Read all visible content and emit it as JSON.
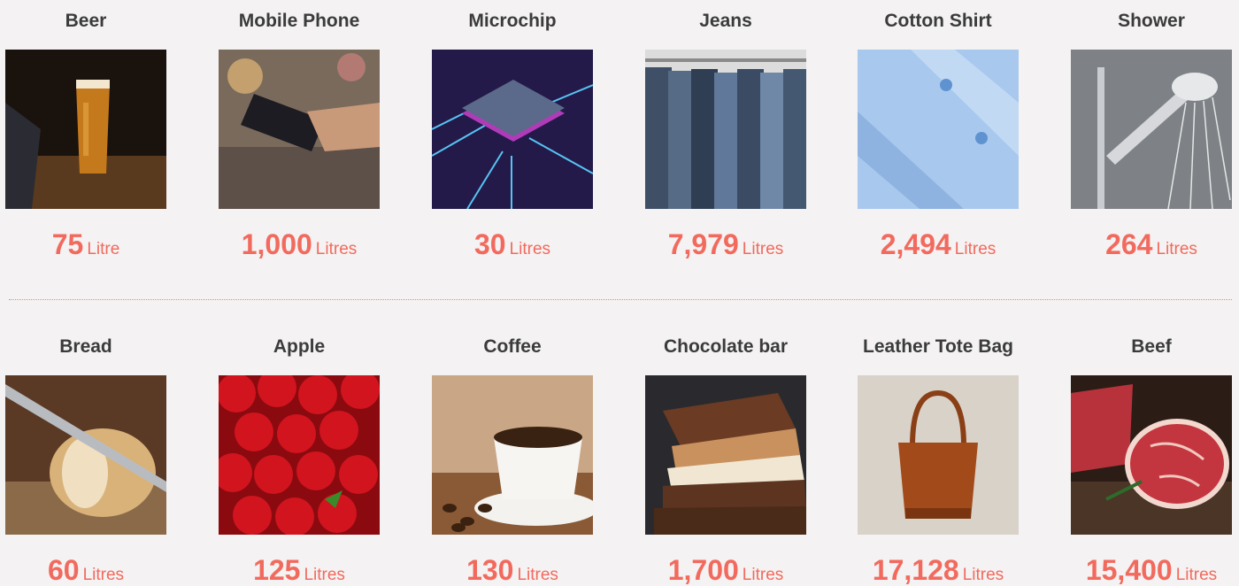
{
  "row1": [
    {
      "label": "Beer",
      "value": "75",
      "unit": "Litre"
    },
    {
      "label": "Mobile Phone",
      "value": "1,000",
      "unit": "Litres"
    },
    {
      "label": "Microchip",
      "value": "30",
      "unit": "Litres"
    },
    {
      "label": "Jeans",
      "value": "7,979",
      "unit": "Litres"
    },
    {
      "label": "Cotton Shirt",
      "value": "2,494",
      "unit": "Litres"
    },
    {
      "label": "Shower",
      "value": "264",
      "unit": "Litres"
    }
  ],
  "row2": [
    {
      "label": "Bread",
      "value": "60",
      "unit": "Litres"
    },
    {
      "label": "Apple",
      "value": "125",
      "unit": "Litres"
    },
    {
      "label": "Coffee",
      "value": "130",
      "unit": "Litres"
    },
    {
      "label": "Chocolate bar",
      "value": "1,700",
      "unit": "Litres"
    },
    {
      "label": "Leather Tote Bag",
      "value": "17,128",
      "unit": "Litres"
    },
    {
      "label": "Beef",
      "value": "15,400",
      "unit": "Litres"
    }
  ],
  "colors": {
    "value_accent": "#f26a5e",
    "title": "#3b3b3b",
    "background": "#f4f2f2"
  }
}
